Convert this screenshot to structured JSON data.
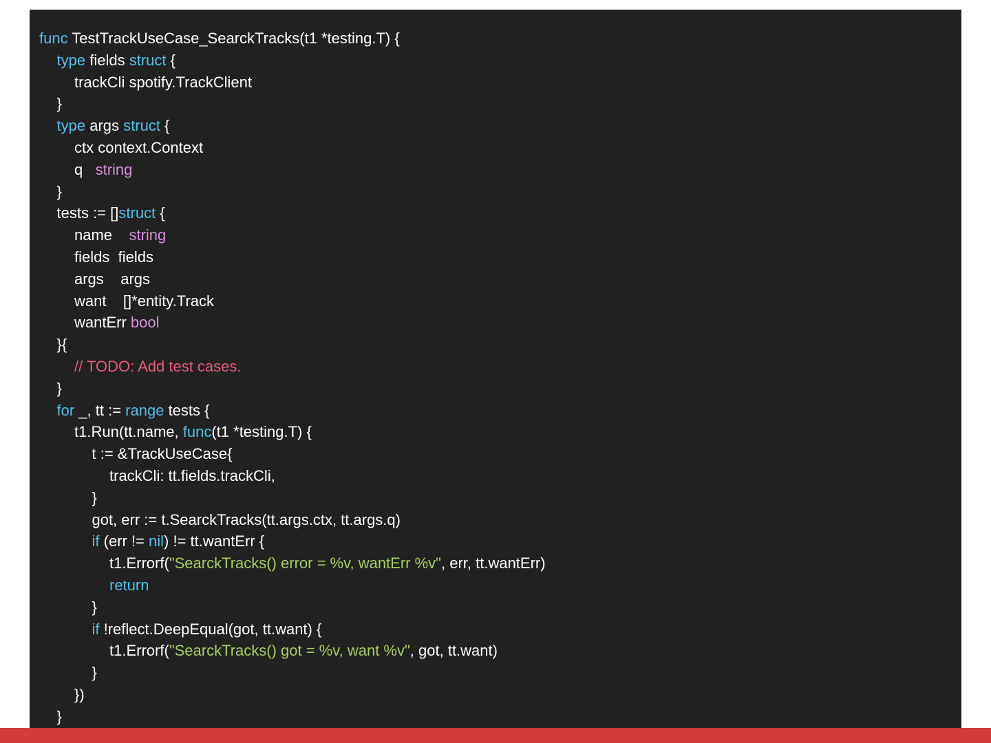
{
  "colors": {
    "background": "#ffffff",
    "panel": "#212121",
    "text": "#ffffff",
    "keyword": "#4fc1e9",
    "builtin_type": "#d88fdd",
    "string": "#a6d15b",
    "comment": "#ec5a7b",
    "footer_bar": "#d13b3b"
  },
  "code": {
    "language": "go",
    "lines": [
      {
        "indent": 0,
        "tokens": [
          {
            "k": "kw",
            "t": "func"
          },
          {
            "k": "plain",
            "t": " TestTrackUseCase_SearckTracks(t1 *testing.T) {"
          }
        ]
      },
      {
        "indent": 1,
        "tokens": [
          {
            "k": "kw",
            "t": "type"
          },
          {
            "k": "plain",
            "t": " fields "
          },
          {
            "k": "kw",
            "t": "struct"
          },
          {
            "k": "plain",
            "t": " {"
          }
        ]
      },
      {
        "indent": 2,
        "tokens": [
          {
            "k": "plain",
            "t": "trackCli spotify.TrackClient"
          }
        ]
      },
      {
        "indent": 1,
        "tokens": [
          {
            "k": "plain",
            "t": "}"
          }
        ]
      },
      {
        "indent": 1,
        "tokens": [
          {
            "k": "kw",
            "t": "type"
          },
          {
            "k": "plain",
            "t": " args "
          },
          {
            "k": "kw",
            "t": "struct"
          },
          {
            "k": "plain",
            "t": " {"
          }
        ]
      },
      {
        "indent": 2,
        "tokens": [
          {
            "k": "plain",
            "t": "ctx context.Context"
          }
        ]
      },
      {
        "indent": 2,
        "tokens": [
          {
            "k": "plain",
            "t": "q   "
          },
          {
            "k": "type",
            "t": "string"
          }
        ]
      },
      {
        "indent": 1,
        "tokens": [
          {
            "k": "plain",
            "t": "}"
          }
        ]
      },
      {
        "indent": 1,
        "tokens": [
          {
            "k": "plain",
            "t": "tests := []"
          },
          {
            "k": "kw",
            "t": "struct"
          },
          {
            "k": "plain",
            "t": " {"
          }
        ]
      },
      {
        "indent": 2,
        "tokens": [
          {
            "k": "plain",
            "t": "name    "
          },
          {
            "k": "type",
            "t": "string"
          }
        ]
      },
      {
        "indent": 2,
        "tokens": [
          {
            "k": "plain",
            "t": "fields  fields"
          }
        ]
      },
      {
        "indent": 2,
        "tokens": [
          {
            "k": "plain",
            "t": "args    args"
          }
        ]
      },
      {
        "indent": 2,
        "tokens": [
          {
            "k": "plain",
            "t": "want    []*entity.Track"
          }
        ]
      },
      {
        "indent": 2,
        "tokens": [
          {
            "k": "plain",
            "t": "wantErr "
          },
          {
            "k": "type",
            "t": "bool"
          }
        ]
      },
      {
        "indent": 1,
        "tokens": [
          {
            "k": "plain",
            "t": "}{"
          }
        ]
      },
      {
        "indent": 2,
        "tokens": [
          {
            "k": "cm",
            "t": "// TODO: Add test cases."
          }
        ]
      },
      {
        "indent": 1,
        "tokens": [
          {
            "k": "plain",
            "t": "}"
          }
        ]
      },
      {
        "indent": 1,
        "tokens": [
          {
            "k": "kw",
            "t": "for"
          },
          {
            "k": "plain",
            "t": " _, tt := "
          },
          {
            "k": "kw",
            "t": "range"
          },
          {
            "k": "plain",
            "t": " tests {"
          }
        ]
      },
      {
        "indent": 2,
        "tokens": [
          {
            "k": "plain",
            "t": "t1.Run(tt.name, "
          },
          {
            "k": "kw",
            "t": "func"
          },
          {
            "k": "plain",
            "t": "(t1 *testing.T) {"
          }
        ]
      },
      {
        "indent": 3,
        "tokens": [
          {
            "k": "plain",
            "t": "t := &TrackUseCase{"
          }
        ]
      },
      {
        "indent": 4,
        "tokens": [
          {
            "k": "plain",
            "t": "trackCli: tt.fields.trackCli,"
          }
        ]
      },
      {
        "indent": 3,
        "tokens": [
          {
            "k": "plain",
            "t": "}"
          }
        ]
      },
      {
        "indent": 3,
        "tokens": [
          {
            "k": "plain",
            "t": "got, err := t.SearckTracks(tt.args.ctx, tt.args.q)"
          }
        ]
      },
      {
        "indent": 3,
        "tokens": [
          {
            "k": "kw",
            "t": "if"
          },
          {
            "k": "plain",
            "t": " (err != "
          },
          {
            "k": "kw",
            "t": "nil"
          },
          {
            "k": "plain",
            "t": ") != tt.wantErr {"
          }
        ]
      },
      {
        "indent": 4,
        "tokens": [
          {
            "k": "plain",
            "t": "t1.Errorf("
          },
          {
            "k": "str",
            "t": "\"SearckTracks() error = %v, wantErr %v\""
          },
          {
            "k": "plain",
            "t": ", err, tt.wantErr)"
          }
        ]
      },
      {
        "indent": 4,
        "tokens": [
          {
            "k": "kw",
            "t": "return"
          }
        ]
      },
      {
        "indent": 3,
        "tokens": [
          {
            "k": "plain",
            "t": "}"
          }
        ]
      },
      {
        "indent": 3,
        "tokens": [
          {
            "k": "kw",
            "t": "if"
          },
          {
            "k": "plain",
            "t": " !reflect.DeepEqual(got, tt.want) {"
          }
        ]
      },
      {
        "indent": 4,
        "tokens": [
          {
            "k": "plain",
            "t": "t1.Errorf("
          },
          {
            "k": "str",
            "t": "\"SearckTracks() got = %v, want %v\""
          },
          {
            "k": "plain",
            "t": ", got, tt.want)"
          }
        ]
      },
      {
        "indent": 3,
        "tokens": [
          {
            "k": "plain",
            "t": "}"
          }
        ]
      },
      {
        "indent": 2,
        "tokens": [
          {
            "k": "plain",
            "t": "})"
          }
        ]
      },
      {
        "indent": 1,
        "tokens": [
          {
            "k": "plain",
            "t": "}"
          }
        ]
      }
    ]
  }
}
